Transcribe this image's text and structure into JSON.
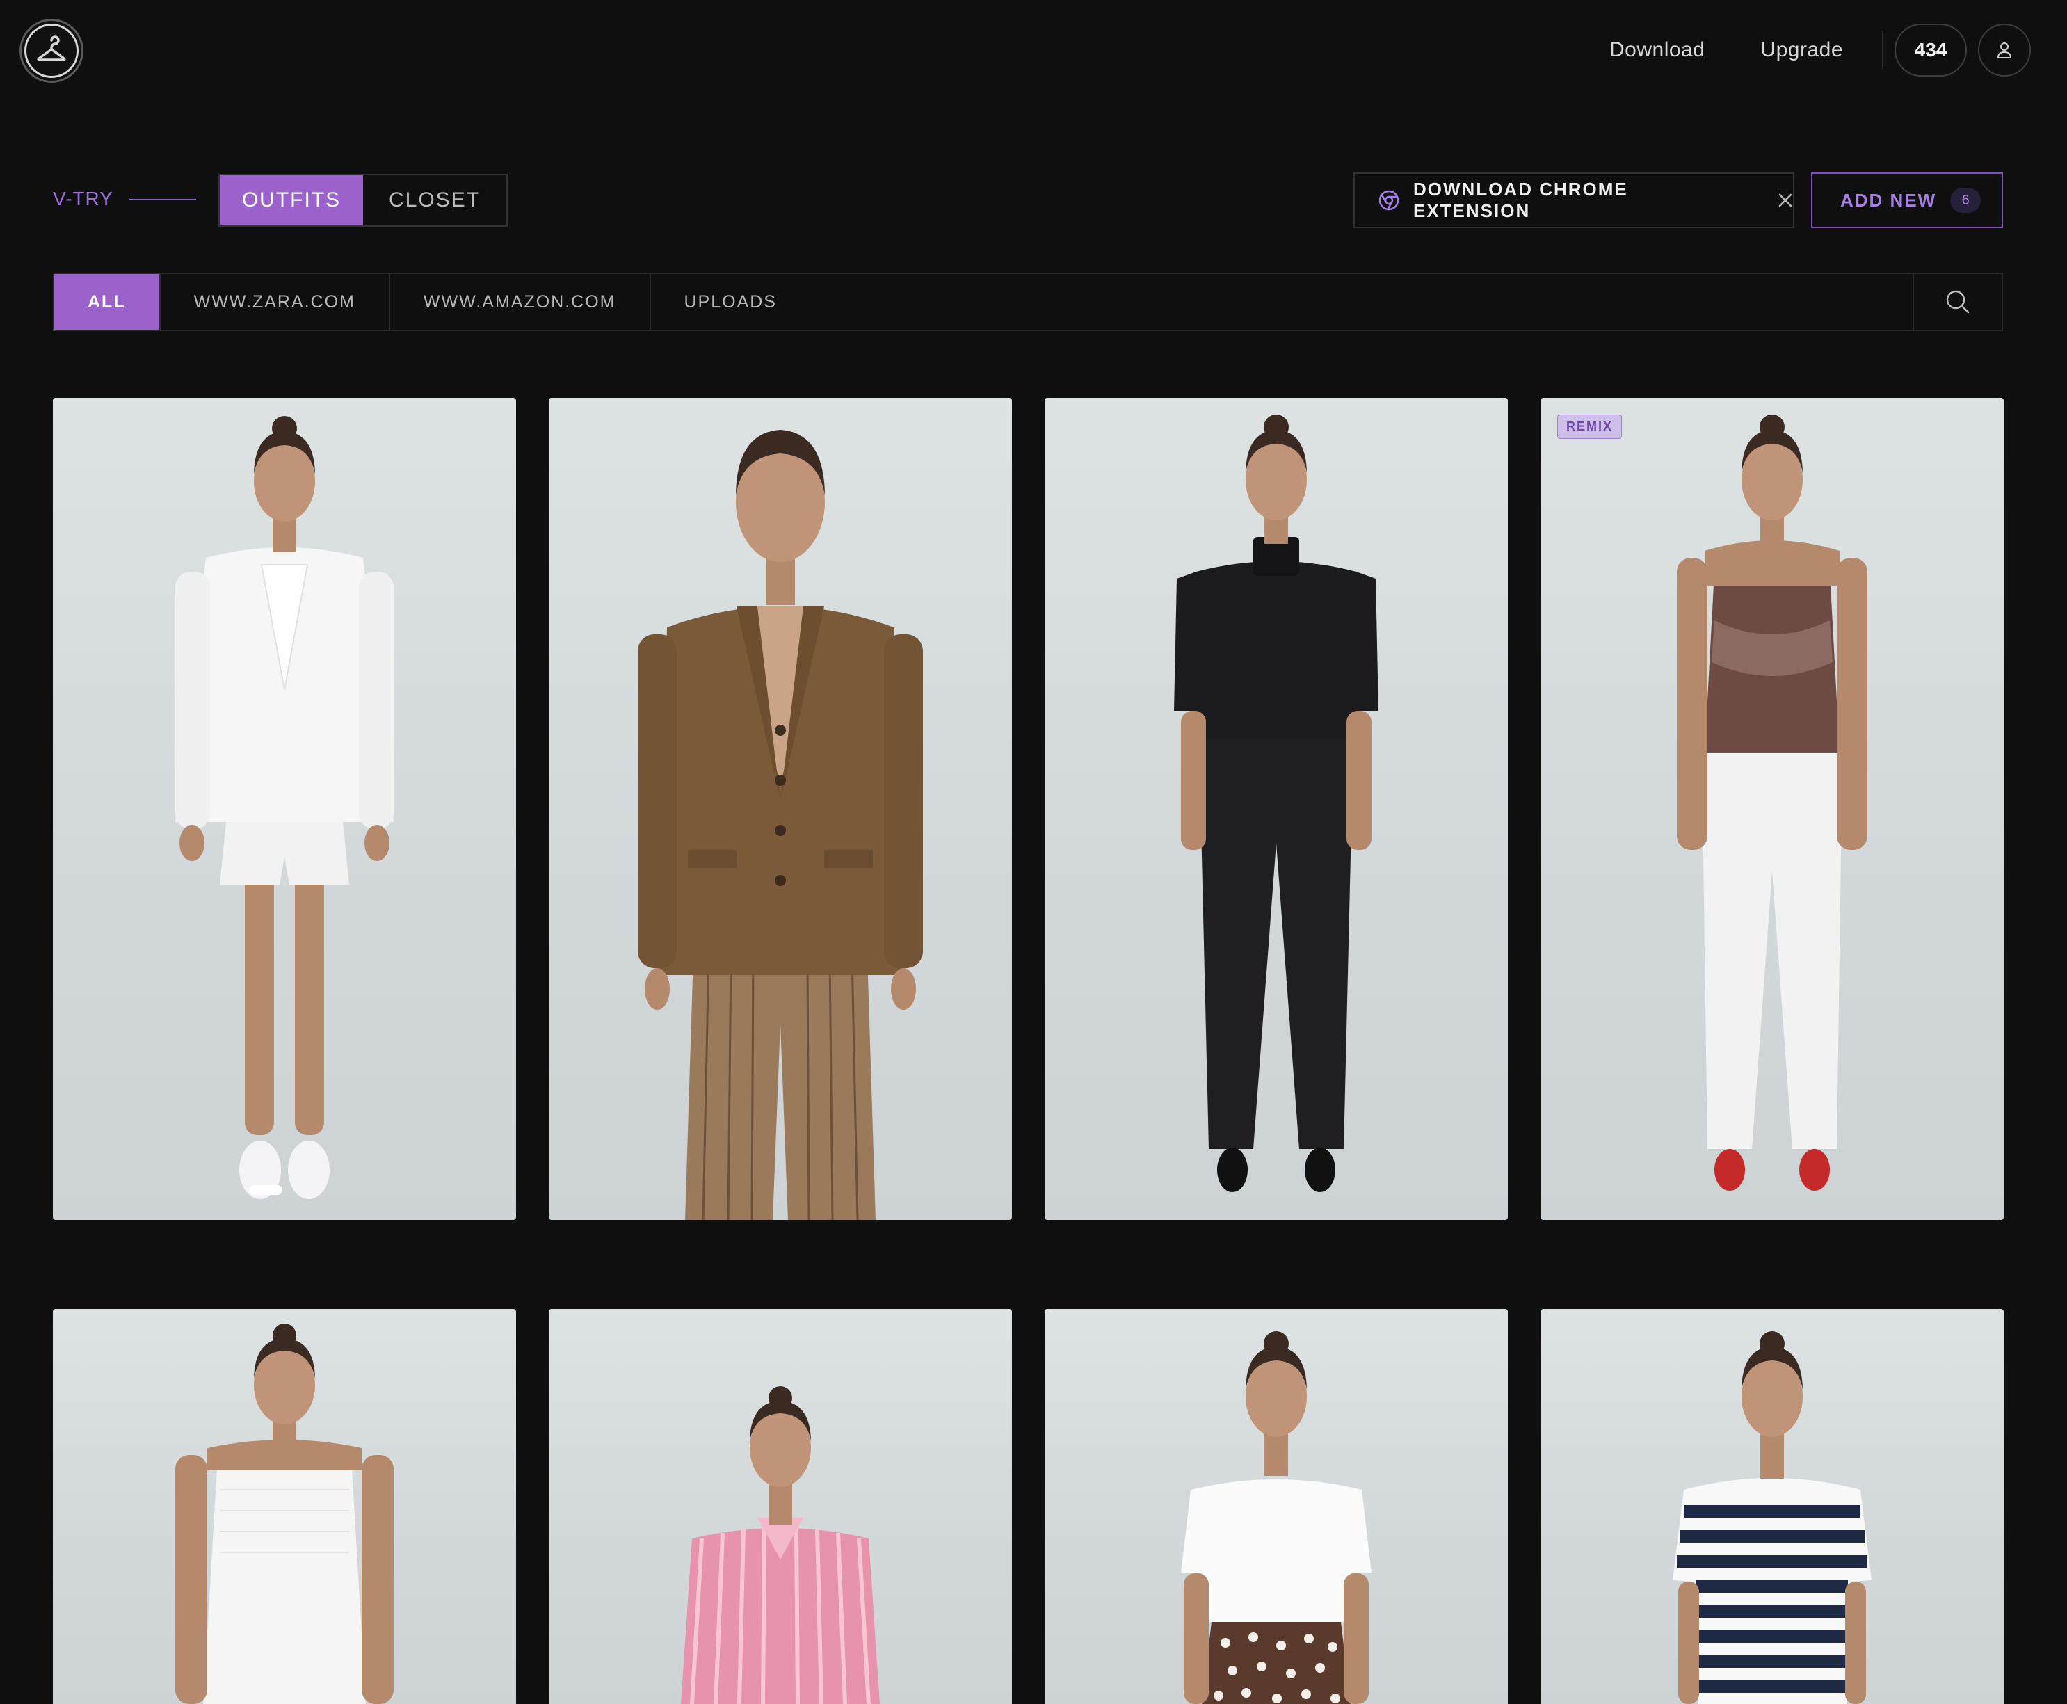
{
  "header": {
    "download_label": "Download",
    "upgrade_label": "Upgrade",
    "credits": "434"
  },
  "toolbar": {
    "brand": "V-TRY",
    "tabs": [
      "OUTFITS",
      "CLOSET"
    ],
    "active_tab": "OUTFITS",
    "extension_label": "DOWNLOAD CHROME EXTENSION",
    "add_new_label": "ADD NEW",
    "add_new_count": "6"
  },
  "filters": {
    "items": [
      "ALL",
      "WWW.ZARA.COM",
      "WWW.AMAZON.COM",
      "UPLOADS"
    ],
    "active": "ALL"
  },
  "outfits": [
    {
      "name": "white eyelet blazer and shorts",
      "badge": null
    },
    {
      "name": "brown tweed blazer with striped trousers",
      "badge": null
    },
    {
      "name": "black cropped jacket and trousers",
      "badge": null
    },
    {
      "name": "tie-dye halter top with white jeans",
      "badge": "REMIX"
    },
    {
      "name": "white strapless smocked dress",
      "badge": null
    },
    {
      "name": "pink striped shirt",
      "badge": null
    },
    {
      "name": "white tee with polka dot skirt",
      "badge": null
    },
    {
      "name": "navy striped tee",
      "badge": null
    }
  ],
  "colors": {
    "accent": "#9b62cc",
    "accent_text": "#a77fe6",
    "background": "#0f0f0f",
    "card_bg": "#d6dcdd"
  },
  "icons": {
    "logo": "hanger-icon",
    "user": "user-icon",
    "extension": "chrome-icon",
    "close": "close-icon",
    "search": "search-icon"
  }
}
